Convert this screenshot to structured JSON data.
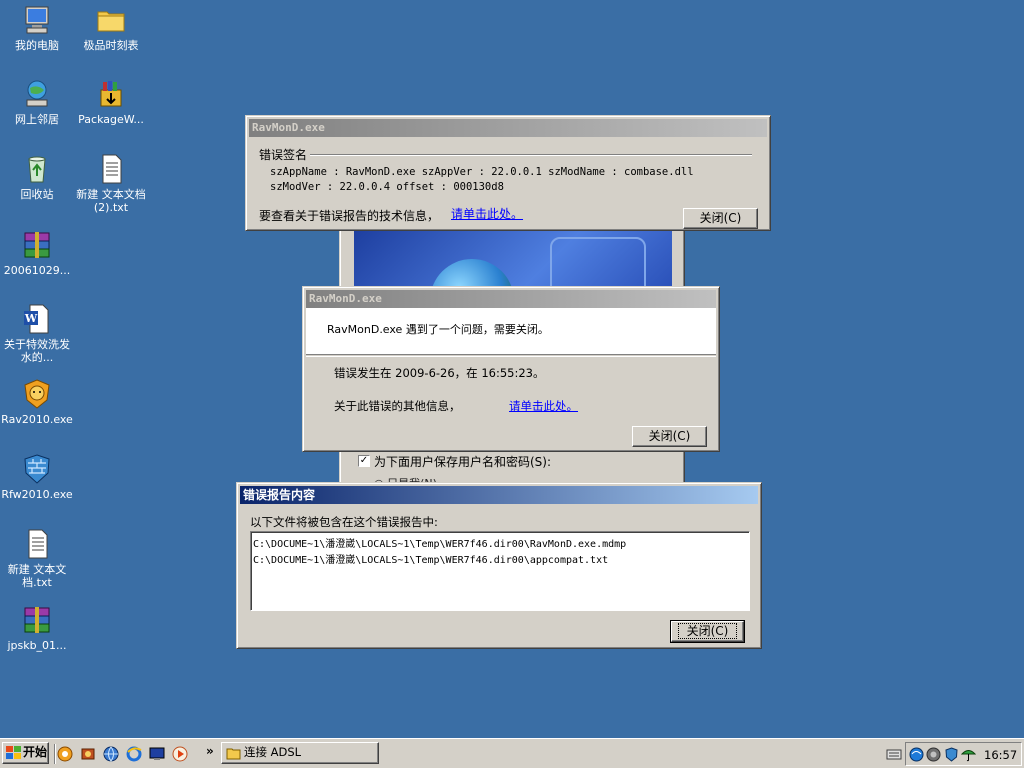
{
  "desktop": {
    "icons": [
      {
        "label": "我的电脑",
        "icon": "computer-icon"
      },
      {
        "label": "极品时刻表",
        "icon": "folder-icon"
      },
      {
        "label": "网上邻居",
        "icon": "network-icon"
      },
      {
        "label": "PackageW...",
        "icon": "installer-package-icon"
      },
      {
        "label": "回收站",
        "icon": "recycle-bin-icon"
      },
      {
        "label": "新建 文本文档 (2).txt",
        "icon": "text-file-icon"
      },
      {
        "label": "20061029...",
        "icon": "rar-archive-icon"
      },
      {
        "label": "关于特效洗发水的...",
        "icon": "word-document-icon"
      },
      {
        "label": "Rav2010.exe",
        "icon": "rising-lion-icon"
      },
      {
        "label": "Rfw2010.exe",
        "icon": "firewall-icon"
      },
      {
        "label": "新建 文本文档.txt",
        "icon": "text-file-icon"
      },
      {
        "label": "jpskb_01...",
        "icon": "rar-archive-icon"
      }
    ]
  },
  "error_signature_dialog": {
    "title": "RavMonD.exe",
    "group_label": "错误签名",
    "line1": "szAppName : RavMonD.exe     szAppVer : 22.0.0.1     szModName : combase.dll",
    "line2": "szModVer : 22.0.0.4     offset : 000130d8",
    "tech_info_text": "要查看关于错误报告的技术信息，",
    "tech_info_link": "请单击此处。",
    "close_label": "关闭(C)"
  },
  "background_dialog": {
    "save_password_label": "为下面用户保存用户名和密码(S):",
    "save_password_checked": true,
    "partial_option": "○ 只是我(N)"
  },
  "problem_dialog": {
    "title": "RavMonD.exe",
    "message": "RavMonD.exe 遇到了一个问题，需要关闭。",
    "occurred_text": "错误发生在 2009-6-26，在 16:55:23。",
    "more_info_text": "关于此错误的其他信息，",
    "more_info_link": "请单击此处。",
    "close_label": "关闭(C)"
  },
  "report_contents_dialog": {
    "title": "错误报告内容",
    "intro": "以下文件将被包含在这个错误报告中:",
    "files": [
      "C:\\DOCUME~1\\潘澄崴\\LOCALS~1\\Temp\\WER7f46.dir00\\RavMonD.exe.mdmp",
      "C:\\DOCUME~1\\潘澄崴\\LOCALS~1\\Temp\\WER7f46.dir00\\appcompat.txt"
    ],
    "close_label": "关闭(C)"
  },
  "taskbar": {
    "start_label": "开始",
    "quick_launch": [
      "qq-icon",
      "media-icon",
      "globe-icon",
      "ie-icon",
      "desktop-icon",
      "player-icon"
    ],
    "overflow": "»",
    "task_button_label": "连接 ADSL",
    "tray_icons": [
      "keyboard-icon",
      "browser-tray-icon",
      "sound-icon",
      "security-icon",
      "umbrella-icon"
    ],
    "clock": "16:57"
  },
  "colors": {
    "desktop": "#3a6ea5",
    "face": "#d4d0c8",
    "active_title": "#0a246a",
    "link": "#0000ff"
  }
}
